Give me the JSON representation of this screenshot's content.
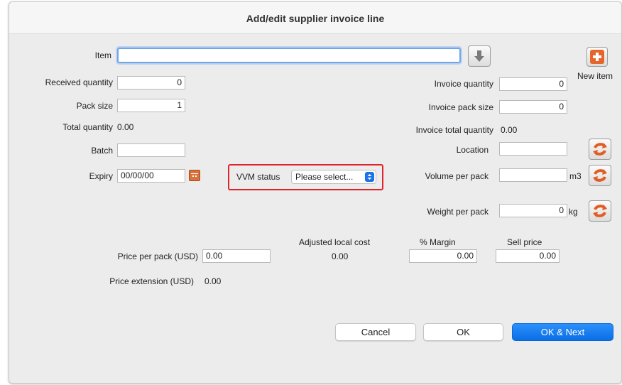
{
  "window": {
    "title": "Add/edit supplier invoice line"
  },
  "item": {
    "label": "Item",
    "value": ""
  },
  "new_item": {
    "label": "New item"
  },
  "left": {
    "received_quantity": {
      "label": "Received quantity",
      "value": "0"
    },
    "pack_size": {
      "label": "Pack size",
      "value": "1"
    },
    "total_quantity": {
      "label": "Total quantity",
      "value": "0.00"
    },
    "batch": {
      "label": "Batch",
      "value": ""
    },
    "expiry": {
      "label": "Expiry",
      "value": "00/00/00"
    }
  },
  "vvm": {
    "label": "VVM status",
    "selected": "Please select..."
  },
  "right": {
    "invoice_quantity": {
      "label": "Invoice quantity",
      "value": "0"
    },
    "invoice_pack_size": {
      "label": "Invoice pack size",
      "value": "0"
    },
    "invoice_total_quantity": {
      "label": "Invoice total quantity",
      "value": "0.00"
    },
    "location": {
      "label": "Location",
      "value": ""
    },
    "volume_per_pack": {
      "label": "Volume per pack",
      "value": "",
      "unit": "m3"
    },
    "weight_per_pack": {
      "label": "Weight per pack",
      "value": "0",
      "unit": "kg"
    }
  },
  "pricing": {
    "price_per_pack": {
      "label": "Price per pack (USD)",
      "value": "0.00"
    },
    "price_extension": {
      "label": "Price extension (USD)",
      "value": "0.00"
    },
    "adjusted_local_cost": {
      "label": "Adjusted local cost",
      "value": "0.00"
    },
    "margin": {
      "label": "% Margin",
      "value": "0.00"
    },
    "sell_price": {
      "label": "Sell price",
      "value": "0.00"
    }
  },
  "buttons": {
    "cancel": "Cancel",
    "ok": "OK",
    "ok_next": "OK & Next"
  },
  "colors": {
    "accent": "#0a6ee6",
    "highlight": "#e0242b",
    "refresh": "#e25d24"
  }
}
